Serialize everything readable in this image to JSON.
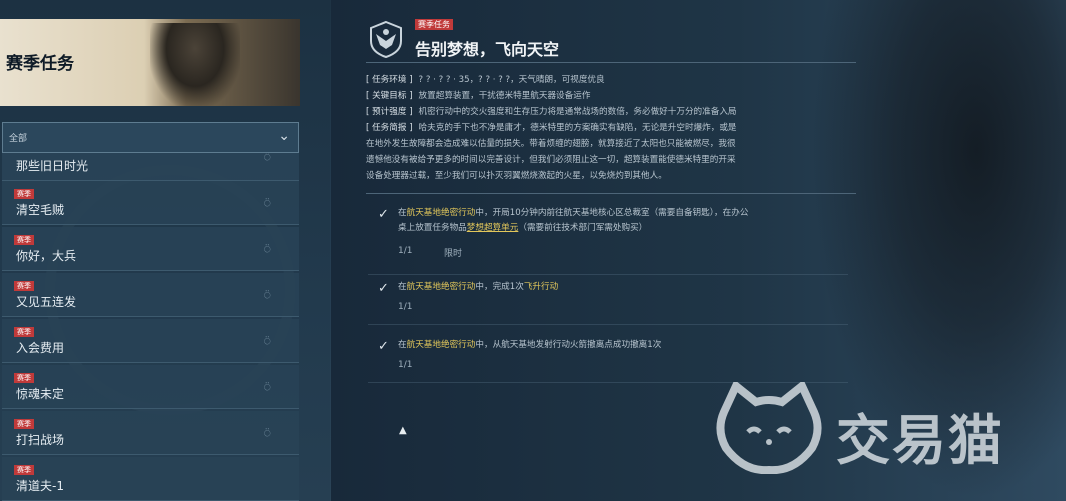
{
  "sidebar": {
    "header_title": "赛季任务",
    "filter_label": "全部",
    "items": [
      {
        "tag": "",
        "label": "那些旧日时光"
      },
      {
        "tag": "赛季",
        "label": "清空毛贼"
      },
      {
        "tag": "赛季",
        "label": "你好，大兵"
      },
      {
        "tag": "赛季",
        "label": "又见五连发"
      },
      {
        "tag": "赛季",
        "label": "入会费用"
      },
      {
        "tag": "赛季",
        "label": "惊魂未定"
      },
      {
        "tag": "赛季",
        "label": "打扫战场"
      },
      {
        "tag": "赛季",
        "label": "清道夫-1"
      }
    ]
  },
  "mission": {
    "tag": "赛季任务",
    "title": "告别梦想，飞向天空",
    "env_key": "[ 任务环境 ]",
    "env_val": "? ? · ? ? · 35，? ? · ? ?，天气晴朗，可视度优良",
    "goal_key": "[ 关键目标 ]",
    "goal_val": "放置超算装置，干扰德米特里航天器设备运作",
    "intensity_key": "[ 预计强度 ]",
    "intensity_val": "机密行动中的交火强度和生存压力将是通常战场的数倍，务必做好十万分的准备入局",
    "brief_key": "[ 任务简报 ]",
    "brief_line1": "哈夫克的手下也不净是庸才，德米特里的方案确实有缺陷，无论是升空时爆炸，或是",
    "brief_line2": "在地外发生故障都会造成难以估量的损失。带着烦缠的翅膀，就算接近了太阳也只能被燃尽，我很",
    "brief_line3": "遗憾他没有被给予更多的时间以完善设计，但我们必须阻止这一切，超算装置能使德米特里的开采",
    "brief_line4": "设备处理器过载，至少我们可以扑灭羽翼燃烧激起的火星，以免烧灼到其他人。"
  },
  "objectives": [
    {
      "pre": "在",
      "hl1": "航天基地绝密行动",
      "mid": "中，开局10分钟内前往航天基地核心区总裁室（需要自备钥匙），在办公",
      "line2_pre": "桌上放置任务物品",
      "hl2": "梦想超算单元",
      "line2_post": "（需要前往技术部门军需处购买）",
      "progress": "1/1",
      "progress_tag": "限时"
    },
    {
      "pre": "在",
      "hl1": "航天基地绝密行动",
      "mid": "中，完成1次",
      "hl2": "飞升行动",
      "progress": "1/1"
    },
    {
      "pre": "在",
      "hl1": "航天基地绝密行动",
      "mid": "中，从航天基地发射行动火箭撤离点成功撤离1次",
      "progress": "1/1"
    }
  ],
  "watermark": {
    "text": "交易猫"
  },
  "colors": {
    "tag_red": "#c03a3a",
    "highlight": "#e2c75b"
  }
}
